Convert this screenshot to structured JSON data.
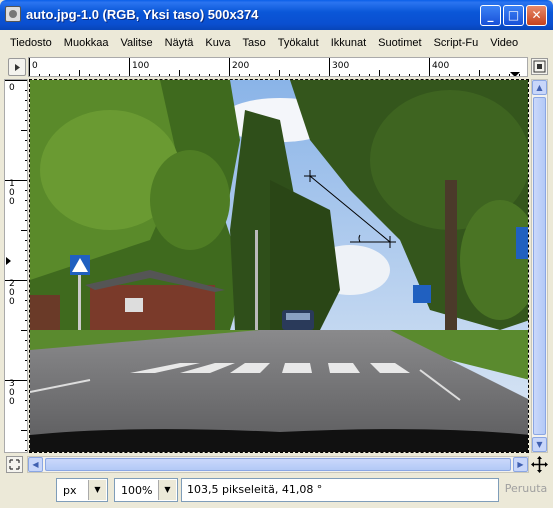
{
  "window": {
    "title": "auto.jpg-1.0 (RGB, Yksi taso) 500x374",
    "minimize_glyph": "_",
    "maximize_glyph": "□",
    "close_glyph": "✕"
  },
  "menu": {
    "items": [
      "Tiedosto",
      "Muokkaa",
      "Valitse",
      "Näytä",
      "Kuva",
      "Taso",
      "Työkalut",
      "Ikkunat",
      "Suotimet",
      "Script-Fu",
      "Video"
    ]
  },
  "rulers": {
    "horizontal_labels": [
      "0",
      "100",
      "200",
      "300",
      "400"
    ],
    "vertical_labels": [
      "0",
      "100",
      "200",
      "300"
    ]
  },
  "statusbar": {
    "unit": "px",
    "zoom": "100%",
    "message": "103,5 pikseleitä, 41,08 °",
    "cancel_label": "Peruuta"
  },
  "icons": {
    "app": "gimp-image-icon",
    "ruler_menu": "triangle-right-icon",
    "navigate": "navigate-icon",
    "zoom_toggle": "zoom-fit-icon",
    "move": "move-cross-icon"
  },
  "colors": {
    "titlebar": "#0a57d8",
    "chrome": "#ece9d8",
    "scroll_thumb": "#b3c9f6"
  }
}
